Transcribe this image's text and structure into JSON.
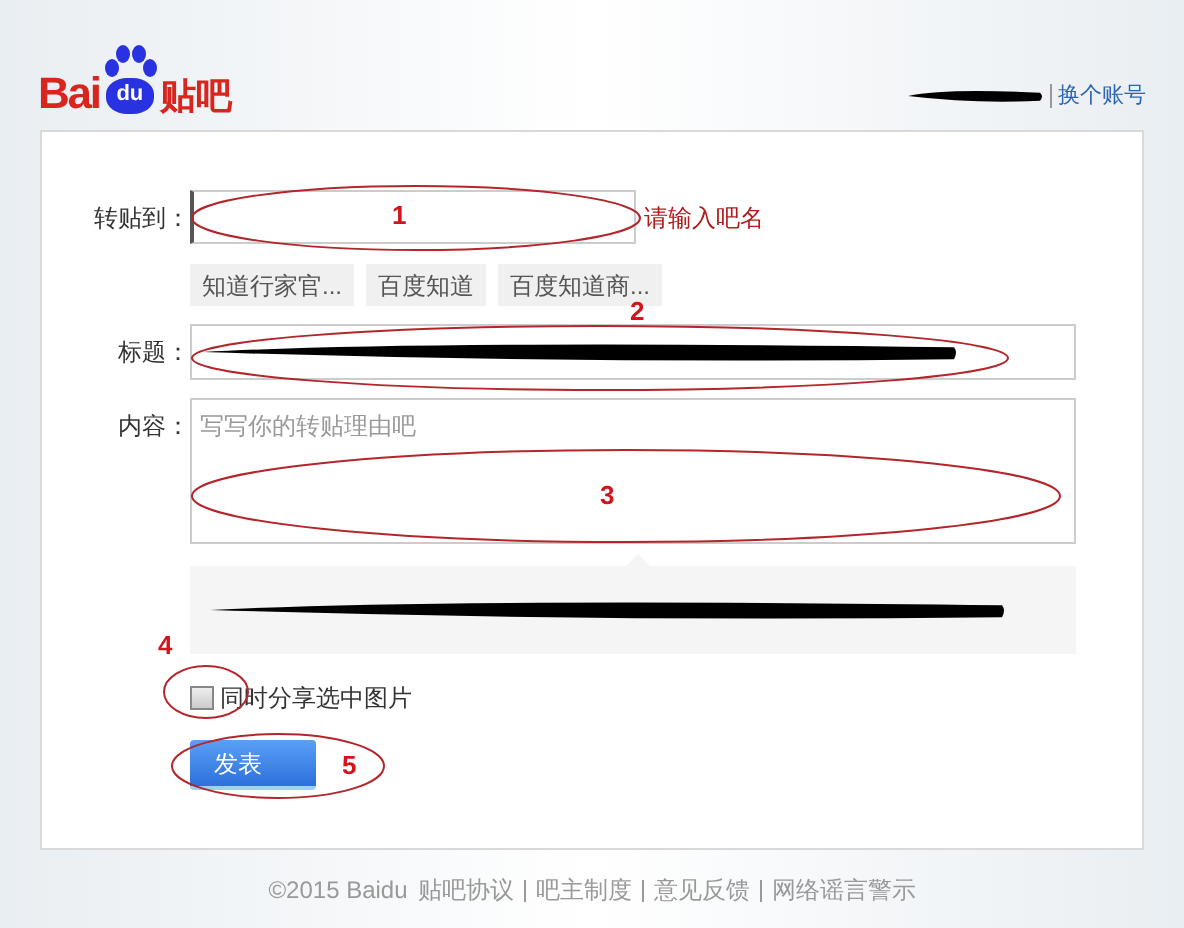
{
  "logo": {
    "latin_left": "Bai",
    "latin_paw": "du",
    "chinese": "贴吧"
  },
  "account": {
    "switch_link": "换个账号"
  },
  "form": {
    "forum_field": {
      "label": "转贴到：",
      "hint": "请输入吧名"
    },
    "forum_tags": [
      "知道行家官...",
      "百度知道",
      "百度知道商..."
    ],
    "title_field": {
      "label": "标题："
    },
    "content_field": {
      "label": "内容：",
      "placeholder": "写写你的转贴理由吧"
    },
    "share_images": {
      "label": "同时分享选中图片",
      "checked": false
    },
    "submit_button": "发表"
  },
  "annotations": [
    "1",
    "2",
    "3",
    "4",
    "5"
  ],
  "footer": {
    "copyright": "©2015 Baidu",
    "links": [
      "贴吧协议",
      "吧主制度",
      "意见反馈",
      "网络谣言警示"
    ]
  }
}
